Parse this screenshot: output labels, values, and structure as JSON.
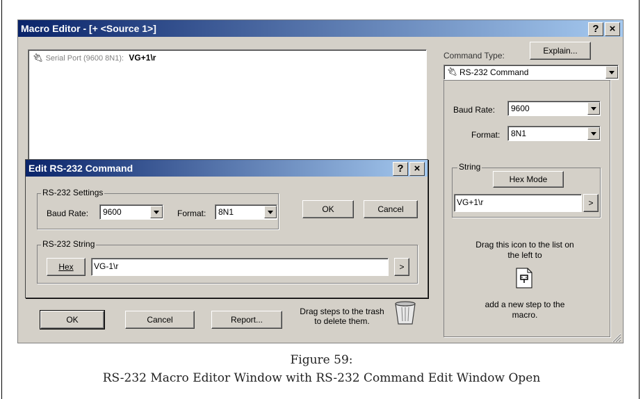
{
  "macro_editor": {
    "title": "Macro Editor - [+ <Source 1>]",
    "help_button": "?",
    "close_button": "×",
    "step_list": [
      {
        "port": "Serial Port (9600 8N1):",
        "command": "VG+1\\r"
      }
    ],
    "ok_label": "OK",
    "cancel_label": "Cancel",
    "report_label": "Report...",
    "trash_hint": "Drag steps to the trash to delete them."
  },
  "command_panel": {
    "command_type_label": "Command Type:",
    "explain_label": "Explain...",
    "command_type_value": "RS-232 Command",
    "baud_label": "Baud Rate:",
    "baud_value": "9600",
    "format_label": "Format:",
    "format_value": "8N1",
    "string_group_label": "String",
    "hex_mode_label": "Hex Mode",
    "string_value": "VG+1\\r",
    "arrow_label": ">",
    "drag_hint_top": "Drag this icon to the list on the left to",
    "drag_hint_bottom": "add a new step to the macro."
  },
  "edit_dialog": {
    "title": "Edit RS-232 Command",
    "help_button": "?",
    "close_button": "×",
    "settings_group_label": "RS-232 Settings",
    "baud_label": "Baud Rate:",
    "baud_value": "9600",
    "format_label": "Format:",
    "format_value": "8N1",
    "ok_label": "OK",
    "cancel_label": "Cancel",
    "string_group_label": "RS-232 String",
    "hex_label": "Hex",
    "string_value": "VG-1\\r",
    "arrow_label": ">"
  },
  "caption": {
    "line1": "Figure 59:",
    "line2": "RS-232 Macro Editor Window with RS-232 Command Edit Window Open"
  }
}
